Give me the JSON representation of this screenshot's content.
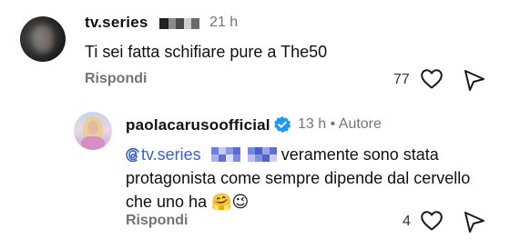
{
  "comments": [
    {
      "username": "tv.series",
      "time": "21 h",
      "text": "Ti sei fatta schifiare pure a The50",
      "reply_label": "Rispondi",
      "likes": "77"
    },
    {
      "username": "paolacarusoofficial",
      "time": "13 h",
      "separator": "•",
      "author_badge": "Autore",
      "mention": "tv.series",
      "text": "veramente sono stata protagonista come sempre dipende dal cervello che uno ha",
      "emojis": "🤗😉",
      "reply_label": "Rispondi",
      "likes": "4"
    }
  ],
  "colors": {
    "verified": "#1d9bf0",
    "mention": "#3a63c8",
    "muted": "#737373"
  },
  "icons": [
    "threads-icon",
    "verified-badge-icon",
    "heart-icon",
    "share-icon"
  ]
}
